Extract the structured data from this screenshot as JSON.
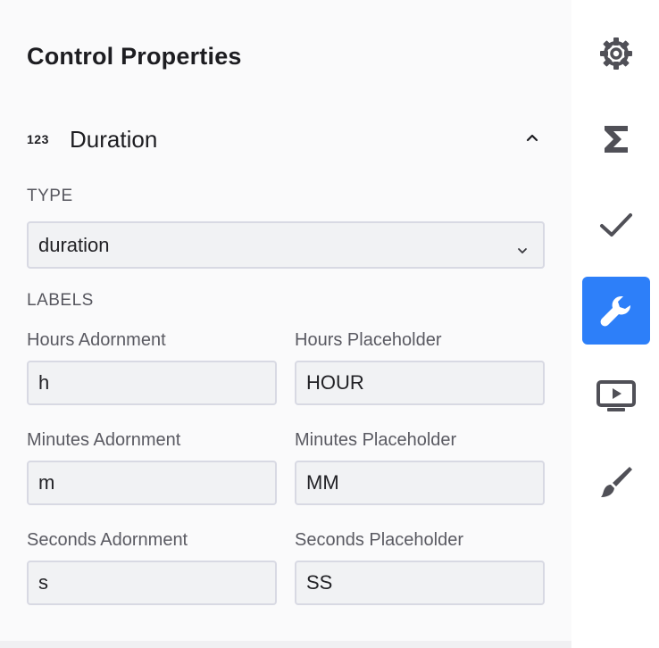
{
  "panel": {
    "title": "Control Properties",
    "section": {
      "icon": "number-123-icon",
      "icon_text": "123",
      "title": "Duration",
      "expanded": true
    },
    "type": {
      "label": "TYPE",
      "value": "duration"
    },
    "labels": {
      "heading": "LABELS",
      "fields": [
        {
          "label": "Hours Adornment",
          "value": "h"
        },
        {
          "label": "Hours Placeholder",
          "value": "HOUR"
        },
        {
          "label": "Minutes Adornment",
          "value": "m"
        },
        {
          "label": "Minutes Placeholder",
          "value": "MM"
        },
        {
          "label": "Seconds Adornment",
          "value": "s"
        },
        {
          "label": "Seconds Placeholder",
          "value": "SS"
        }
      ]
    }
  },
  "rail": {
    "items": [
      {
        "icon": "gear-icon",
        "active": false
      },
      {
        "icon": "sigma-icon",
        "active": false
      },
      {
        "icon": "checkmark-icon",
        "active": false
      },
      {
        "icon": "wrench-icon",
        "active": true
      },
      {
        "icon": "play-screen-icon",
        "active": false
      },
      {
        "icon": "paintbrush-icon",
        "active": false
      }
    ]
  },
  "colors": {
    "accent": "#2d7ff9",
    "field_bg": "#f1f2f4",
    "field_border": "#d8d9e3"
  }
}
